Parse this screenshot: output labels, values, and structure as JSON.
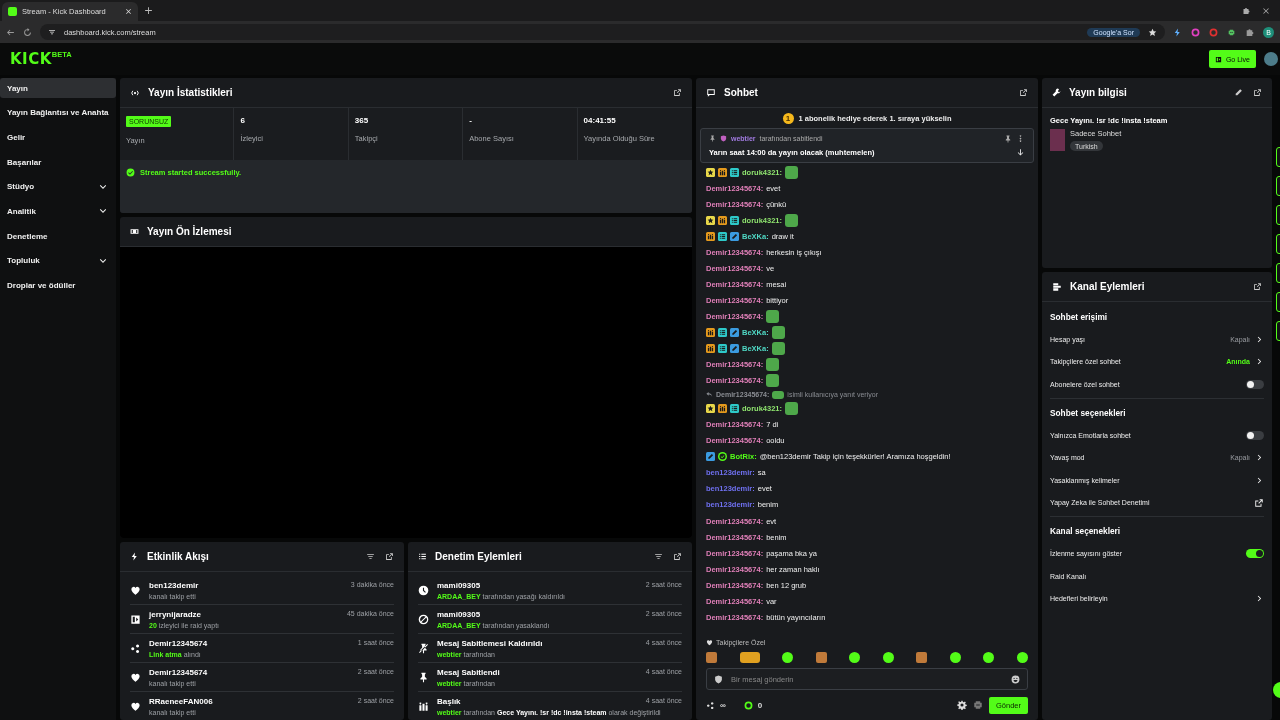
{
  "browser": {
    "tab_title": "Stream - Kick Dashboard",
    "url": "dashboard.kick.com/stream",
    "ask_chip": "Google'a Sor",
    "profile_initial": "B"
  },
  "header": {
    "logo": "KICK",
    "logo_badge": "BETA",
    "go_live": "Go Live"
  },
  "sidebar": {
    "items": [
      {
        "label": "Yayın",
        "kind": "link",
        "selected": true
      },
      {
        "label": "Yayın Bağlantısı ve Anahta",
        "kind": "link",
        "selected": false
      },
      {
        "label": "Gelir",
        "kind": "link",
        "selected": false
      },
      {
        "label": "Başarılar",
        "kind": "link",
        "selected": false
      },
      {
        "label": "Stüdyo",
        "kind": "group",
        "selected": false
      },
      {
        "label": "Analitik",
        "kind": "group",
        "selected": false
      },
      {
        "label": "Denetleme",
        "kind": "link",
        "selected": false
      },
      {
        "label": "Topluluk",
        "kind": "group",
        "selected": false
      },
      {
        "label": "Droplar ve ödüller",
        "kind": "link",
        "selected": false
      }
    ]
  },
  "stats": {
    "title": "Yayın İstatistikleri",
    "status_badge": "SORUNSUZ",
    "status_label": "Yayın",
    "items": [
      {
        "value": "6",
        "label": "İzleyici"
      },
      {
        "value": "365",
        "label": "Takipçi"
      },
      {
        "value": "-",
        "label": "Abone Sayısı"
      },
      {
        "value": "04:41:55",
        "label": "Yayında Olduğu Süre"
      }
    ],
    "notice": "Stream started successfully."
  },
  "preview": {
    "title": "Yayın Ön İzlemesi"
  },
  "activity": {
    "title": "Etkinlik Akışı",
    "items": [
      {
        "kind": "heart",
        "user": "ben123demir",
        "detail": "kanalı takip etti",
        "time": "3 dakika önce"
      },
      {
        "kind": "raid",
        "user": "jerrynijaradze",
        "detail": "**20** izleyici ile raid yaptı",
        "time": "45 dakika önce"
      },
      {
        "kind": "reward",
        "user": "Demir12345674",
        "detail": "**Link atma** alındı",
        "time": "1 saat önce"
      },
      {
        "kind": "heart",
        "user": "Demir12345674",
        "detail": "kanalı takip etti",
        "time": "2 saat önce"
      },
      {
        "kind": "heart",
        "user": "RRaeneeFAN006",
        "detail": "kanalı takip etti",
        "time": "2 saat önce"
      }
    ]
  },
  "moderation": {
    "title": "Denetim Eylemleri",
    "items": [
      {
        "kind": "unban",
        "user": "mami09305",
        "detail": "**ARDAA_BEY** tarafından yasağı kaldırıldı",
        "time": "2 saat önce"
      },
      {
        "kind": "ban",
        "user": "mami09305",
        "detail": "**ARDAA_BEY** tarafından yasaklandı",
        "time": "2 saat önce"
      },
      {
        "kind": "unpin",
        "user": "Mesaj Sabitlemesi Kaldırıldı",
        "detail": "**webtier** tarafından",
        "time": "4 saat önce"
      },
      {
        "kind": "pin",
        "user": "Mesaj Sabitlendi",
        "detail": "**webtier** tarafından",
        "time": "4 saat önce"
      },
      {
        "kind": "title",
        "user": "Başlık",
        "detail": "**webtier** tarafından **Gece Yayını. !sr !dc !insta !steam** olarak değiştirildi",
        "time": "4 saat önce"
      }
    ]
  },
  "chat": {
    "title": "Sohbet",
    "banner_rank": "1",
    "banner": "1 abonelik hediye ederek 1. sıraya yükselin",
    "pinned": {
      "by": "webtier",
      "by_suffix": "tarafından sabitlendi",
      "text": "Yarın saat 14:00 da yayın olacak (muhtemelen)"
    },
    "messages": [
      {
        "kind": "emote",
        "user": "doruk4321:",
        "color": "#8fe46f",
        "badges": [
          {
            "kind": "sub"
          },
          {
            "kind": "crown"
          },
          {
            "kind": "og"
          }
        ]
      },
      {
        "kind": "text",
        "user": "Demir12345674:",
        "color": "#e07fb8",
        "text": "evet"
      },
      {
        "kind": "text",
        "user": "Demir12345674:",
        "color": "#e07fb8",
        "text": "çünkü"
      },
      {
        "kind": "emote",
        "user": "doruk4321:",
        "color": "#8fe46f",
        "badges": [
          {
            "kind": "sub"
          },
          {
            "kind": "crown"
          },
          {
            "kind": "og"
          }
        ]
      },
      {
        "kind": "text",
        "user": "BeXKa:",
        "color": "#4fd8c4",
        "badges": [
          {
            "kind": "crown"
          },
          {
            "kind": "og"
          },
          {
            "kind": "mod"
          }
        ],
        "text": "draw it"
      },
      {
        "kind": "text",
        "user": "Demir12345674:",
        "color": "#e07fb8",
        "text": "herkesin iş çıkışı"
      },
      {
        "kind": "text",
        "user": "Demir12345674:",
        "color": "#e07fb8",
        "text": "ve"
      },
      {
        "kind": "text",
        "user": "Demir12345674:",
        "color": "#e07fb8",
        "text": "mesai"
      },
      {
        "kind": "text",
        "user": "Demir12345674:",
        "color": "#e07fb8",
        "text": "bittiyor"
      },
      {
        "kind": "emote",
        "user": "Demir12345674:",
        "color": "#e07fb8"
      },
      {
        "kind": "emote",
        "user": "BeXKa:",
        "color": "#4fd8c4",
        "badges": [
          {
            "kind": "crown"
          },
          {
            "kind": "og"
          },
          {
            "kind": "mod"
          }
        ]
      },
      {
        "kind": "emote",
        "user": "BeXKa:",
        "color": "#4fd8c4",
        "badges": [
          {
            "kind": "crown"
          },
          {
            "kind": "og"
          },
          {
            "kind": "mod"
          }
        ]
      },
      {
        "kind": "emote",
        "user": "Demir12345674:",
        "color": "#e07fb8"
      },
      {
        "kind": "emote",
        "user": "Demir12345674:",
        "color": "#e07fb8"
      },
      {
        "kind": "reply",
        "user": "Demir12345674:",
        "color": "#8a8d93",
        "text": "isimli kullanıcıya yanıt veriyor"
      },
      {
        "kind": "emote",
        "user": "doruk4321:",
        "color": "#8fe46f",
        "badges": [
          {
            "kind": "sub"
          },
          {
            "kind": "crown"
          },
          {
            "kind": "og"
          }
        ]
      },
      {
        "kind": "text",
        "user": "Demir12345674:",
        "color": "#e07fb8",
        "text": "7 di"
      },
      {
        "kind": "text",
        "user": "Demir12345674:",
        "color": "#e07fb8",
        "text": "ooldu"
      },
      {
        "kind": "text",
        "user": "BotRix:",
        "color": "#53fc18",
        "badges": [
          {
            "kind": "mod"
          },
          {
            "kind": "verified"
          }
        ],
        "text": "@ben123demir Takip için teşekkürler! Aramıza hoşgeldin!"
      },
      {
        "kind": "text",
        "user": "ben123demir:",
        "color": "#6f70f0",
        "text": "sa"
      },
      {
        "kind": "text",
        "user": "ben123demir:",
        "color": "#6f70f0",
        "text": "evet"
      },
      {
        "kind": "text",
        "user": "ben123demir:",
        "color": "#6f70f0",
        "text": "benim"
      },
      {
        "kind": "text",
        "user": "Demir12345674:",
        "color": "#e07fb8",
        "text": "evt"
      },
      {
        "kind": "text",
        "user": "Demir12345674:",
        "color": "#e07fb8",
        "text": "benim"
      },
      {
        "kind": "text",
        "user": "Demir12345674:",
        "color": "#e07fb8",
        "text": "paşama bka ya"
      },
      {
        "kind": "text",
        "user": "Demir12345674:",
        "color": "#e07fb8",
        "text": "her zaman haklı"
      },
      {
        "kind": "text",
        "user": "Demir12345674:",
        "color": "#e07fb8",
        "text": "ben 12 grub"
      },
      {
        "kind": "text",
        "user": "Demir12345674:",
        "color": "#e07fb8",
        "text": "var"
      },
      {
        "kind": "text",
        "user": "Demir12345674:",
        "color": "#e07fb8",
        "text": "bütün yayıncıların"
      }
    ],
    "emote_label": "Takipçilere Özel",
    "input_placeholder": "Bir mesaj gönderin",
    "points": "∞",
    "coins": "0",
    "send": "Gönder"
  },
  "stream_info": {
    "title": "Yayın bilgisi",
    "stream_title": "Gece Yayını. !sr !dc !insta !steam",
    "category": "Sadece Sohbet",
    "tag": "Turkish"
  },
  "channel_actions": {
    "title": "Kanal Eylemleri",
    "sections": [
      {
        "title": "Sohbet erişimi",
        "rows": [
          {
            "kind": "select",
            "label": "Hesap yaşı",
            "value": "Kapalı",
            "active": false
          },
          {
            "kind": "select",
            "label": "Takipçilere özel sohbet",
            "value": "Anında",
            "active": true
          },
          {
            "kind": "toggle",
            "label": "Abonelere özel sohbet",
            "on": false
          }
        ]
      },
      {
        "title": "Sohbet seçenekleri",
        "rows": [
          {
            "kind": "toggle",
            "label": "Yalnızca Emotlarla sohbet",
            "on": false
          },
          {
            "kind": "select",
            "label": "Yavaş mod",
            "value": "Kapalı",
            "active": false
          },
          {
            "kind": "nav",
            "label": "Yasaklanmış kelimeler"
          },
          {
            "kind": "external",
            "label": "Yapay Zeka ile Sohbet Denetimi"
          }
        ]
      },
      {
        "title": "Kanal seçenekleri",
        "rows": [
          {
            "kind": "toggle",
            "label": "İzlenme sayısını göster",
            "on": true
          },
          {
            "kind": "plain",
            "label": "Raid Kanalı"
          },
          {
            "kind": "nav",
            "label": "Hedefleri belirleyin"
          }
        ]
      }
    ]
  }
}
